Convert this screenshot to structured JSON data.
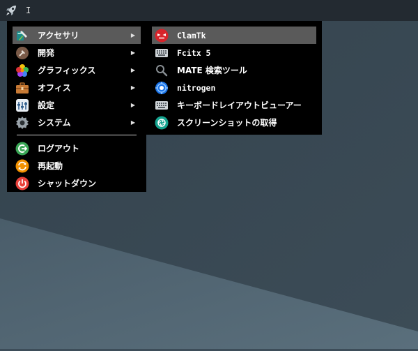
{
  "panel": {
    "launcher_icon": "rocket-icon",
    "cursor_text": "I"
  },
  "main_menu": {
    "items": [
      {
        "label": "アクセサリ",
        "icon": "accessories-icon",
        "has_submenu": true,
        "active": true
      },
      {
        "label": "開発",
        "icon": "development-icon",
        "has_submenu": true
      },
      {
        "label": "グラフィックス",
        "icon": "graphics-icon",
        "has_submenu": true
      },
      {
        "label": "オフィス",
        "icon": "office-icon",
        "has_submenu": true
      },
      {
        "label": "設定",
        "icon": "settings-icon",
        "has_submenu": true
      },
      {
        "label": "システム",
        "icon": "system-icon",
        "has_submenu": true
      }
    ],
    "session_items": [
      {
        "label": "ログアウト",
        "icon": "logout-icon"
      },
      {
        "label": "再起動",
        "icon": "restart-icon"
      },
      {
        "label": "シャットダウン",
        "icon": "shutdown-icon"
      }
    ],
    "arrow_glyph": "▶"
  },
  "sub_menu": {
    "items": [
      {
        "label": "ClamTk",
        "icon": "clamtk-icon",
        "active": true
      },
      {
        "label": "Fcitx 5",
        "icon": "keyboard-icon"
      },
      {
        "label": "MATE 検索ツール",
        "icon": "search-icon"
      },
      {
        "label": "nitrogen",
        "icon": "nitrogen-icon"
      },
      {
        "label": "キーボードレイアウトビューアー",
        "icon": "keyboard-icon"
      },
      {
        "label": "スクリーンショットの取得",
        "icon": "screenshot-icon"
      }
    ]
  },
  "colors": {
    "panel_bg": "#232a31",
    "menu_bg": "#000000",
    "highlight": "#5a5a5a",
    "desktop_dark": "#3b4a55",
    "desktop_light": "#536775"
  }
}
